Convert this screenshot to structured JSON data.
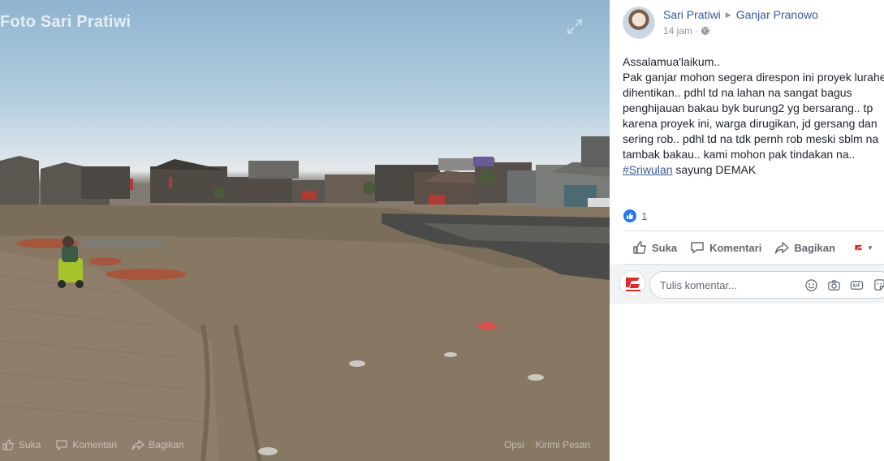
{
  "photo": {
    "title": "Foto Sari Pratiwi",
    "bar": {
      "like_label": "Suka",
      "comment_label": "Komentari",
      "share_label": "Bagikan",
      "right_1": "Opsi",
      "right_2": "Kirimi Pesan"
    }
  },
  "post": {
    "author": "Sari Pratiwi",
    "target": "Ganjar Pranowo",
    "time": "14 jam",
    "audience_icon": "globe-icon",
    "text_lines": [
      "Assalamua'laikum..",
      "Pak ganjar mohon segera direspon ini proyek lurahe",
      "dihentikan.. pdhl td na lahan na sangat bagus",
      "penghijauan bakau byk burung2 yg bersarang.. tp",
      "karena proyek ini, warga dirugikan, jd gersang dan",
      "sering rob.. pdhl td na tdk pernh rob meski sblm na",
      "tambak bakau.. kami mohon pak tindakan na.."
    ],
    "hashtag": "#Sriwulan",
    "last_line_rest": " sayung DEMAK",
    "reaction_count": "1"
  },
  "actions": {
    "like": "Suka",
    "comment": "Komentari",
    "share": "Bagikan"
  },
  "comment": {
    "placeholder": "Tulis komentar..."
  },
  "colors": {
    "link": "#385898",
    "like_blue": "#2078f4",
    "text": "#1d2129",
    "muted": "#90949c"
  }
}
